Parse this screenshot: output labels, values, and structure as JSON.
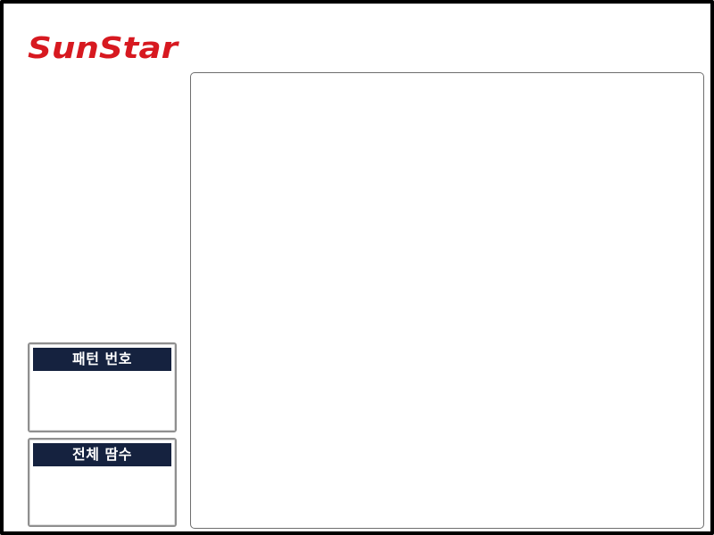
{
  "brand": {
    "logo_text": "SunStar",
    "logo_color": "#d71920"
  },
  "panels": {
    "pattern_number": {
      "label": "패턴 번호",
      "value": ""
    },
    "total_stitches": {
      "label": "전체 땀수",
      "value": ""
    }
  },
  "colors": {
    "frame": "#000000",
    "panel_header_bg": "#15223f",
    "panel_header_text": "#ffffff",
    "background": "#ffffff"
  }
}
